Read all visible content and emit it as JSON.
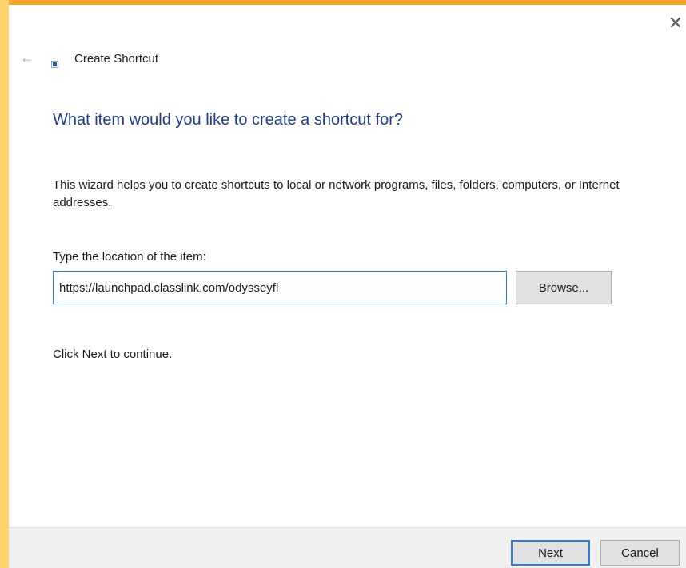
{
  "window": {
    "title": "Create Shortcut",
    "close_glyph": "✕",
    "back_glyph": "←"
  },
  "icons": {
    "close": "close-icon",
    "back": "back-arrow-icon",
    "wizard": "shortcut-icon"
  },
  "page": {
    "heading": "What item would you like to create a shortcut for?",
    "description": "This wizard helps you to create shortcuts to local or network programs, files, folders, computers, or Internet addresses.",
    "location_label": "Type the location of the item:",
    "location_value": "https://launchpad.classlink.com/odysseyfl",
    "browse_label": "Browse...",
    "continue_text": "Click Next to continue."
  },
  "footer": {
    "next_label": "Next",
    "cancel_label": "Cancel"
  },
  "colors": {
    "heading": "#1d3c8f",
    "accent": "#2d7cd6",
    "footer_bg": "#f0f0f0",
    "desktop": "#f7c64a"
  }
}
